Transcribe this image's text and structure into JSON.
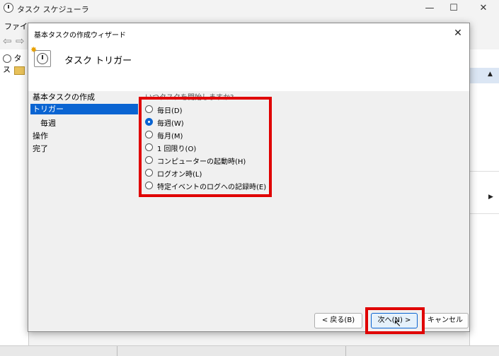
{
  "main_window": {
    "title": "タスク スケジューラ",
    "minimize": "—",
    "maximize": "☐",
    "close": "✕",
    "menu_file": "ファイル",
    "tree_root_label": "タス",
    "tree_expand": "›"
  },
  "dialog": {
    "title": "基本タスクの作成ウィザード",
    "close": "✕",
    "header_title": "タスク トリガー",
    "question": "いつタスクを開始しますか?",
    "steps": [
      {
        "label": "基本タスクの作成",
        "active": false
      },
      {
        "label": "トリガー",
        "active": true
      },
      {
        "label": "毎週",
        "active": false
      },
      {
        "label": "操作",
        "active": false
      },
      {
        "label": "完了",
        "active": false
      }
    ],
    "options": [
      {
        "label": "毎日(D)",
        "checked": false
      },
      {
        "label": "毎週(W)",
        "checked": true
      },
      {
        "label": "毎月(M)",
        "checked": false
      },
      {
        "label": "1 回限り(O)",
        "checked": false
      },
      {
        "label": "コンピューターの起動時(H)",
        "checked": false
      },
      {
        "label": "ログオン時(L)",
        "checked": false
      },
      {
        "label": "特定イベントのログへの記録時(E)",
        "checked": false
      }
    ],
    "buttons": {
      "back": "< 戻る(B)",
      "next": "次へ(N) >",
      "cancel": "キャンセル"
    }
  },
  "colors": {
    "selection": "#0a64d2",
    "highlight": "#e00000"
  }
}
